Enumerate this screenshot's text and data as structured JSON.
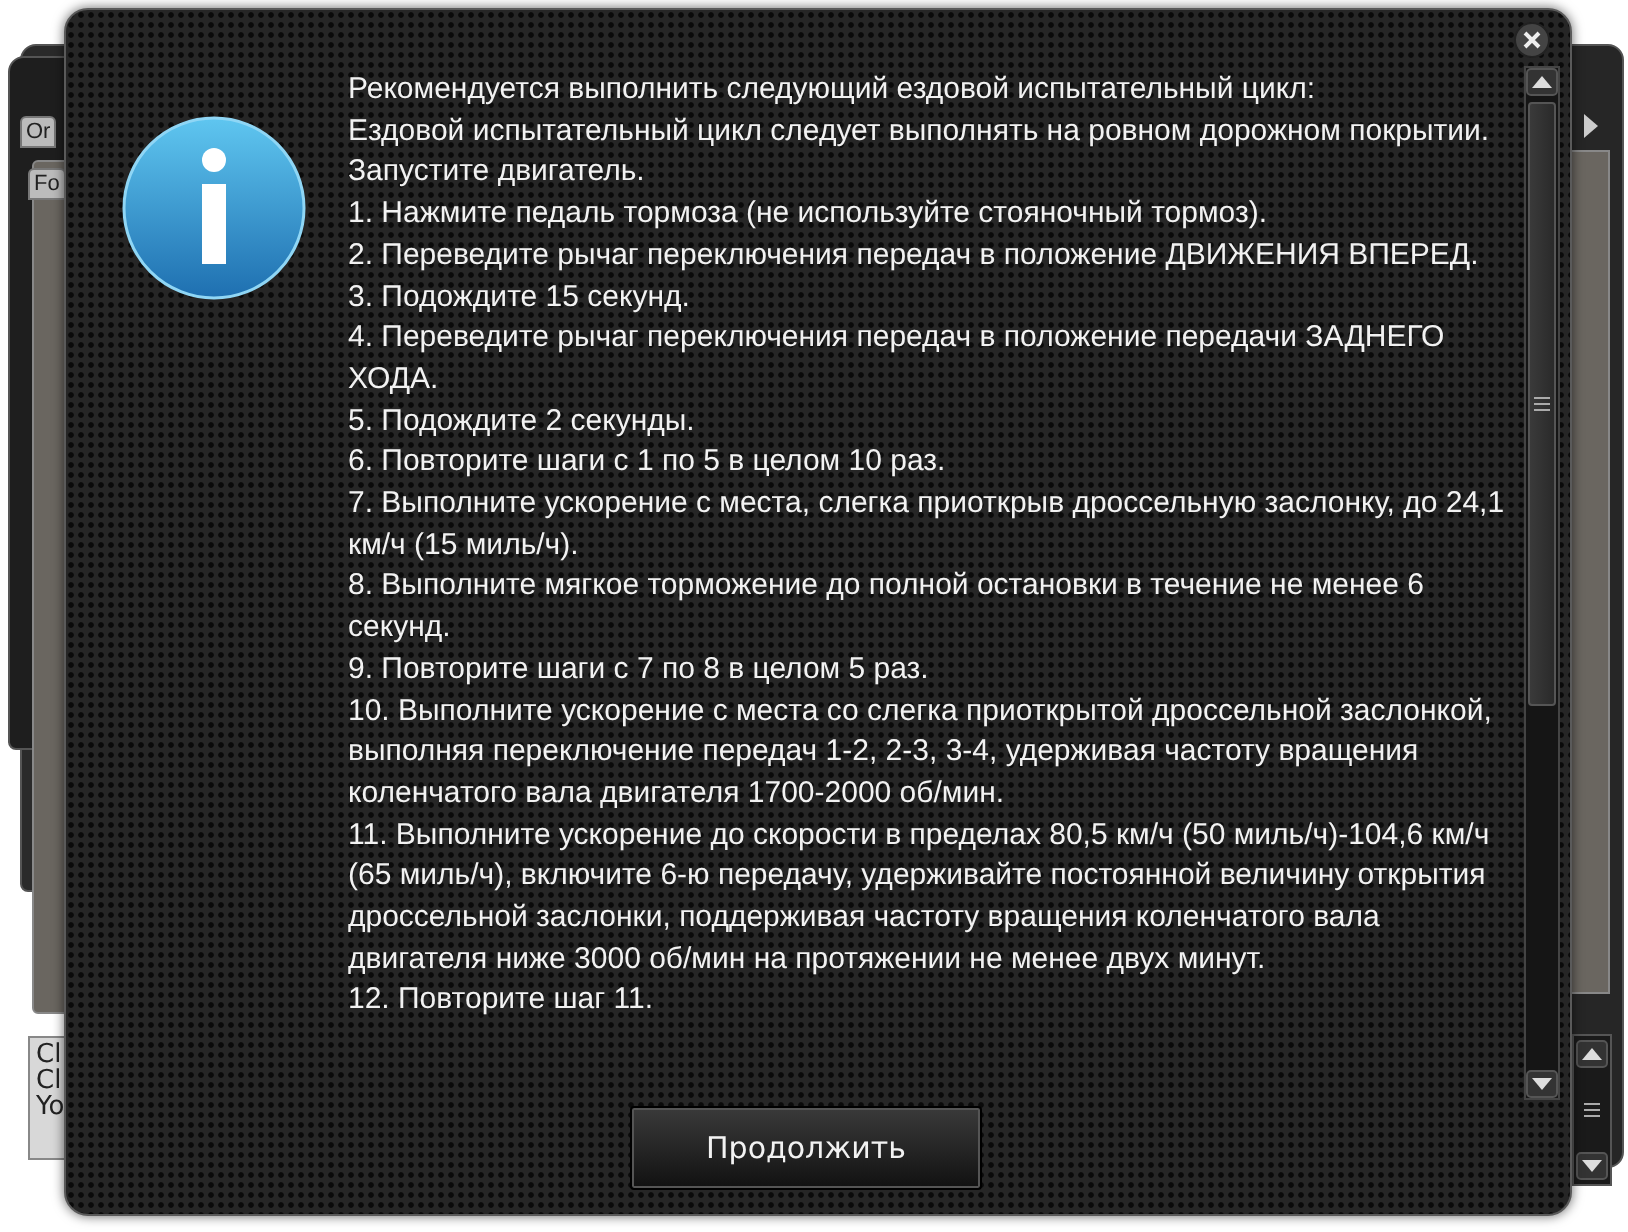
{
  "background_windows": {
    "left": {
      "tabs": [
        "Or",
        "Fo"
      ],
      "log_lines": [
        "Cl",
        "Cl",
        "Yo"
      ]
    }
  },
  "dialog": {
    "paragraphs": [
      "Рекомендуется выполнить следующий ездовой испытательный цикл:",
      "Ездовой испытательный цикл следует выполнять на ровном дорожном покрытии. Запустите двигатель.",
      "1. Нажмите педаль тормоза (не используйте стояночный тормоз).",
      "2. Переведите рычаг переключения передач в положение ДВИЖЕНИЯ ВПЕРЕД.",
      "3. Подождите 15 секунд.",
      "4. Переведите рычаг переключения передач в положение передачи ЗАДНЕГО ХОДА.",
      "5. Подождите 2 секунды.",
      "6. Повторите шаги с 1 по 5 в целом 10 раз.",
      "7. Выполните ускорение с места, слегка приоткрыв дроссельную заслонку, до 24,1 км/ч (15 миль/ч).",
      "8. Выполните мягкое торможение до полной остановки в течение не менее 6 секунд.",
      "9. Повторите шаги с 7 по 8 в целом 5 раз.",
      "10. Выполните ускорение с места со слегка приоткрытой дроссельной заслонкой, выполняя переключение передач 1-2, 2-3, 3-4, удерживая частоту вращения коленчатого вала двигателя 1700-2000 об/мин.",
      "11. Выполните ускорение до скорости в пределах 80,5 км/ч (50 миль/ч)-104,6 км/ч (65 миль/ч), включите 6-ю передачу, удерживайте постоянной величину открытия дроссельной заслонки, поддерживая частоту вращения коленчатого вала двигателя ниже 3000 об/мин на протяжении не менее двух минут.",
      "12. Повторите шаг 11."
    ],
    "button": "Продолжить"
  }
}
